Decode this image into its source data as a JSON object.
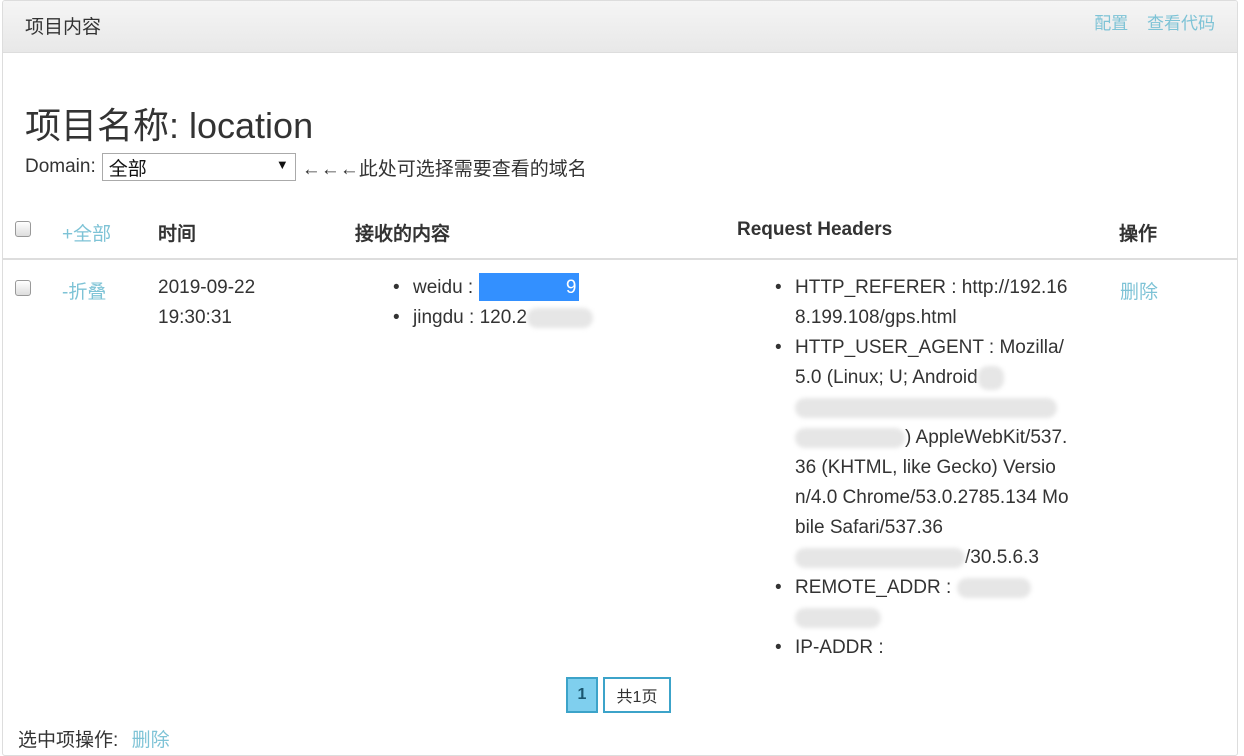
{
  "header": {
    "title": "项目内容",
    "config_link": "配置",
    "view_code_link": "查看代码"
  },
  "project": {
    "title": "项目名称: location"
  },
  "domain": {
    "label": "Domain:",
    "selected": "全部",
    "hint": "←←←此处可选择需要查看的域名"
  },
  "table": {
    "columns": {
      "expand_all": "+全部",
      "time": "时间",
      "content": "接收的内容",
      "headers": "Request Headers",
      "action": "操作"
    },
    "rows": [
      {
        "toggle": "-折叠",
        "time_date": "2019-09-22",
        "time_clock": "19:30:31",
        "content": [
          {
            "key": "weidu",
            "sep": " : ",
            "value_end": "9"
          },
          {
            "key": "jingdu",
            "sep": " : ",
            "value": "120.2"
          }
        ],
        "headers": {
          "referer": "HTTP_REFERER : http://192.168.199.108/gps.html",
          "ua_line1": "HTTP_USER_AGENT : Mozilla/5.0 (Linux; U; Android",
          "ua_line3": ") AppleWebKit/537.36 (KHTML, like Gecko) Version/4.0 Chrome/53.0.2785.134 Mobile Safari/537.36",
          "ua_tail": "/30.5.6.3",
          "remote_addr": "REMOTE_ADDR :",
          "ip_addr": "IP-ADDR :"
        },
        "delete": "删除"
      }
    ]
  },
  "pagination": {
    "current": "1",
    "total": "共1页"
  },
  "footer": {
    "label": "选中项操作:",
    "delete": "删除"
  },
  "colors": {
    "link": "#7ec3d6",
    "selection_highlight": "#3390ff",
    "page_active_bg": "#7fcfee"
  }
}
